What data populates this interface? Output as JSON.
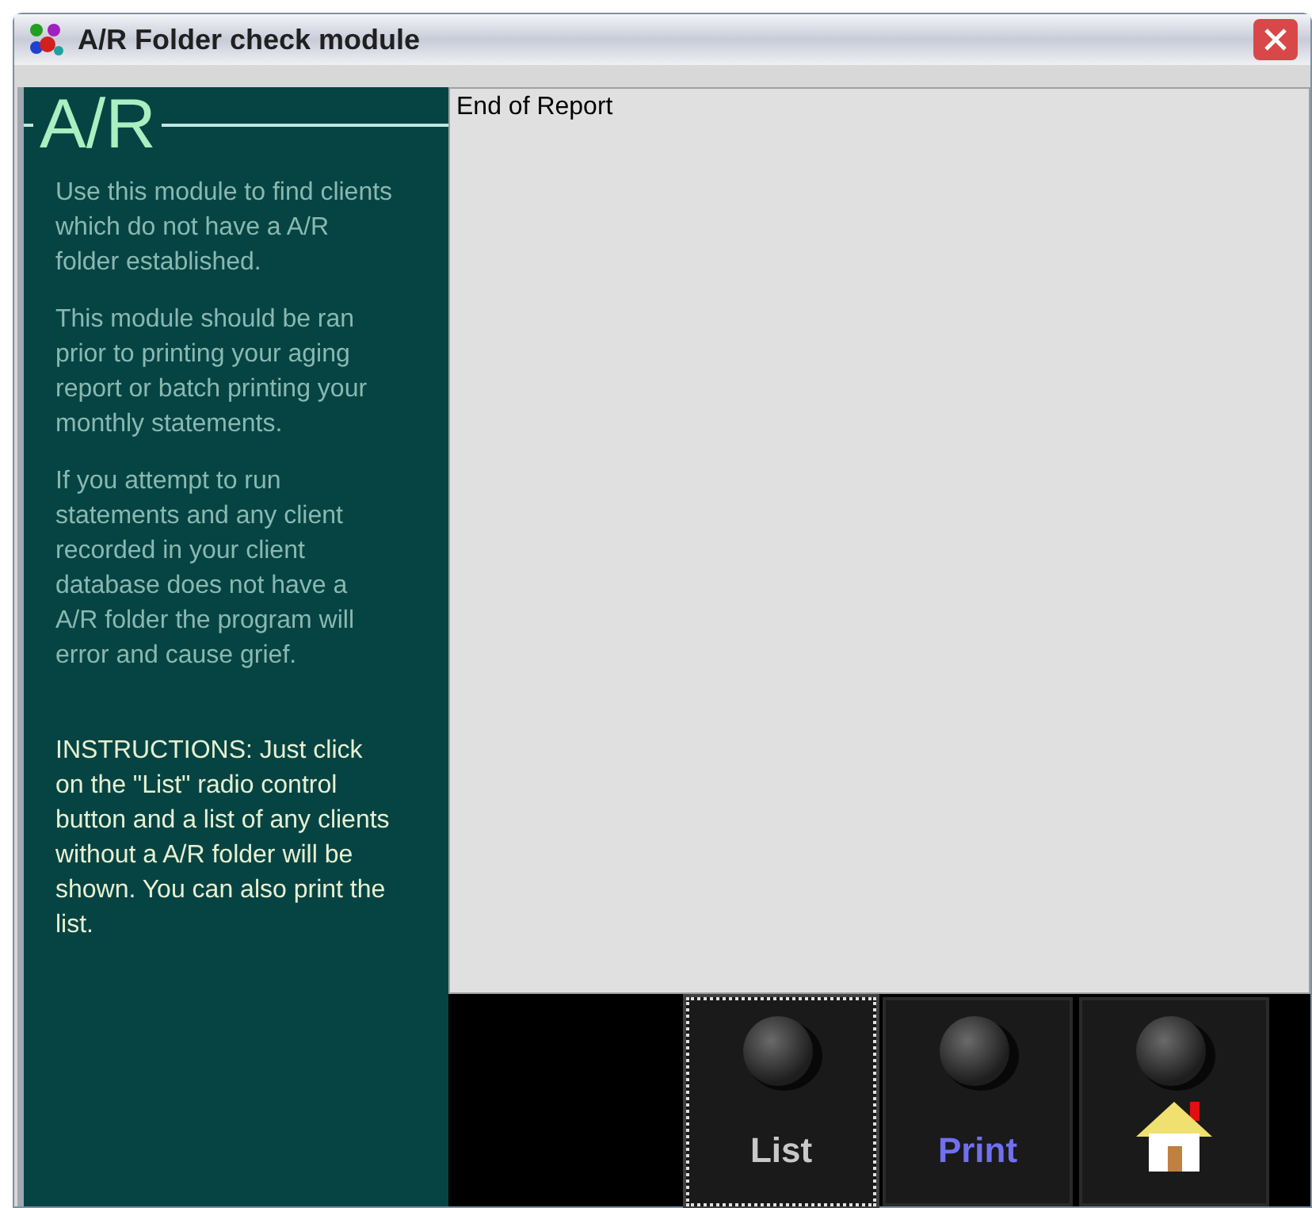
{
  "window": {
    "title": "A/R Folder check module"
  },
  "sidebar": {
    "heading": "A/R",
    "paragraphs": [
      {
        "kind": "note",
        "text": "Use this module to find clients which do not have a A/R folder established."
      },
      {
        "kind": "note",
        "text": "This module should be ran prior to printing your aging report or batch printing your monthly statements."
      },
      {
        "kind": "note",
        "text": "If you attempt to run statements and any client recorded in your client database does not have a A/R folder the program will error and cause grief."
      },
      {
        "kind": "instructions",
        "text": "INSTRUCTIONS: Just click on the \"List\" radio control button and a list of any clients without a A/R folder will be shown. You can also print the list."
      }
    ]
  },
  "report": {
    "text": "End of Report"
  },
  "buttons": [
    {
      "kind": "list",
      "label": "List",
      "selected": true
    },
    {
      "kind": "print",
      "label": "Print",
      "selected": false
    },
    {
      "kind": "home",
      "selected": false
    }
  ]
}
